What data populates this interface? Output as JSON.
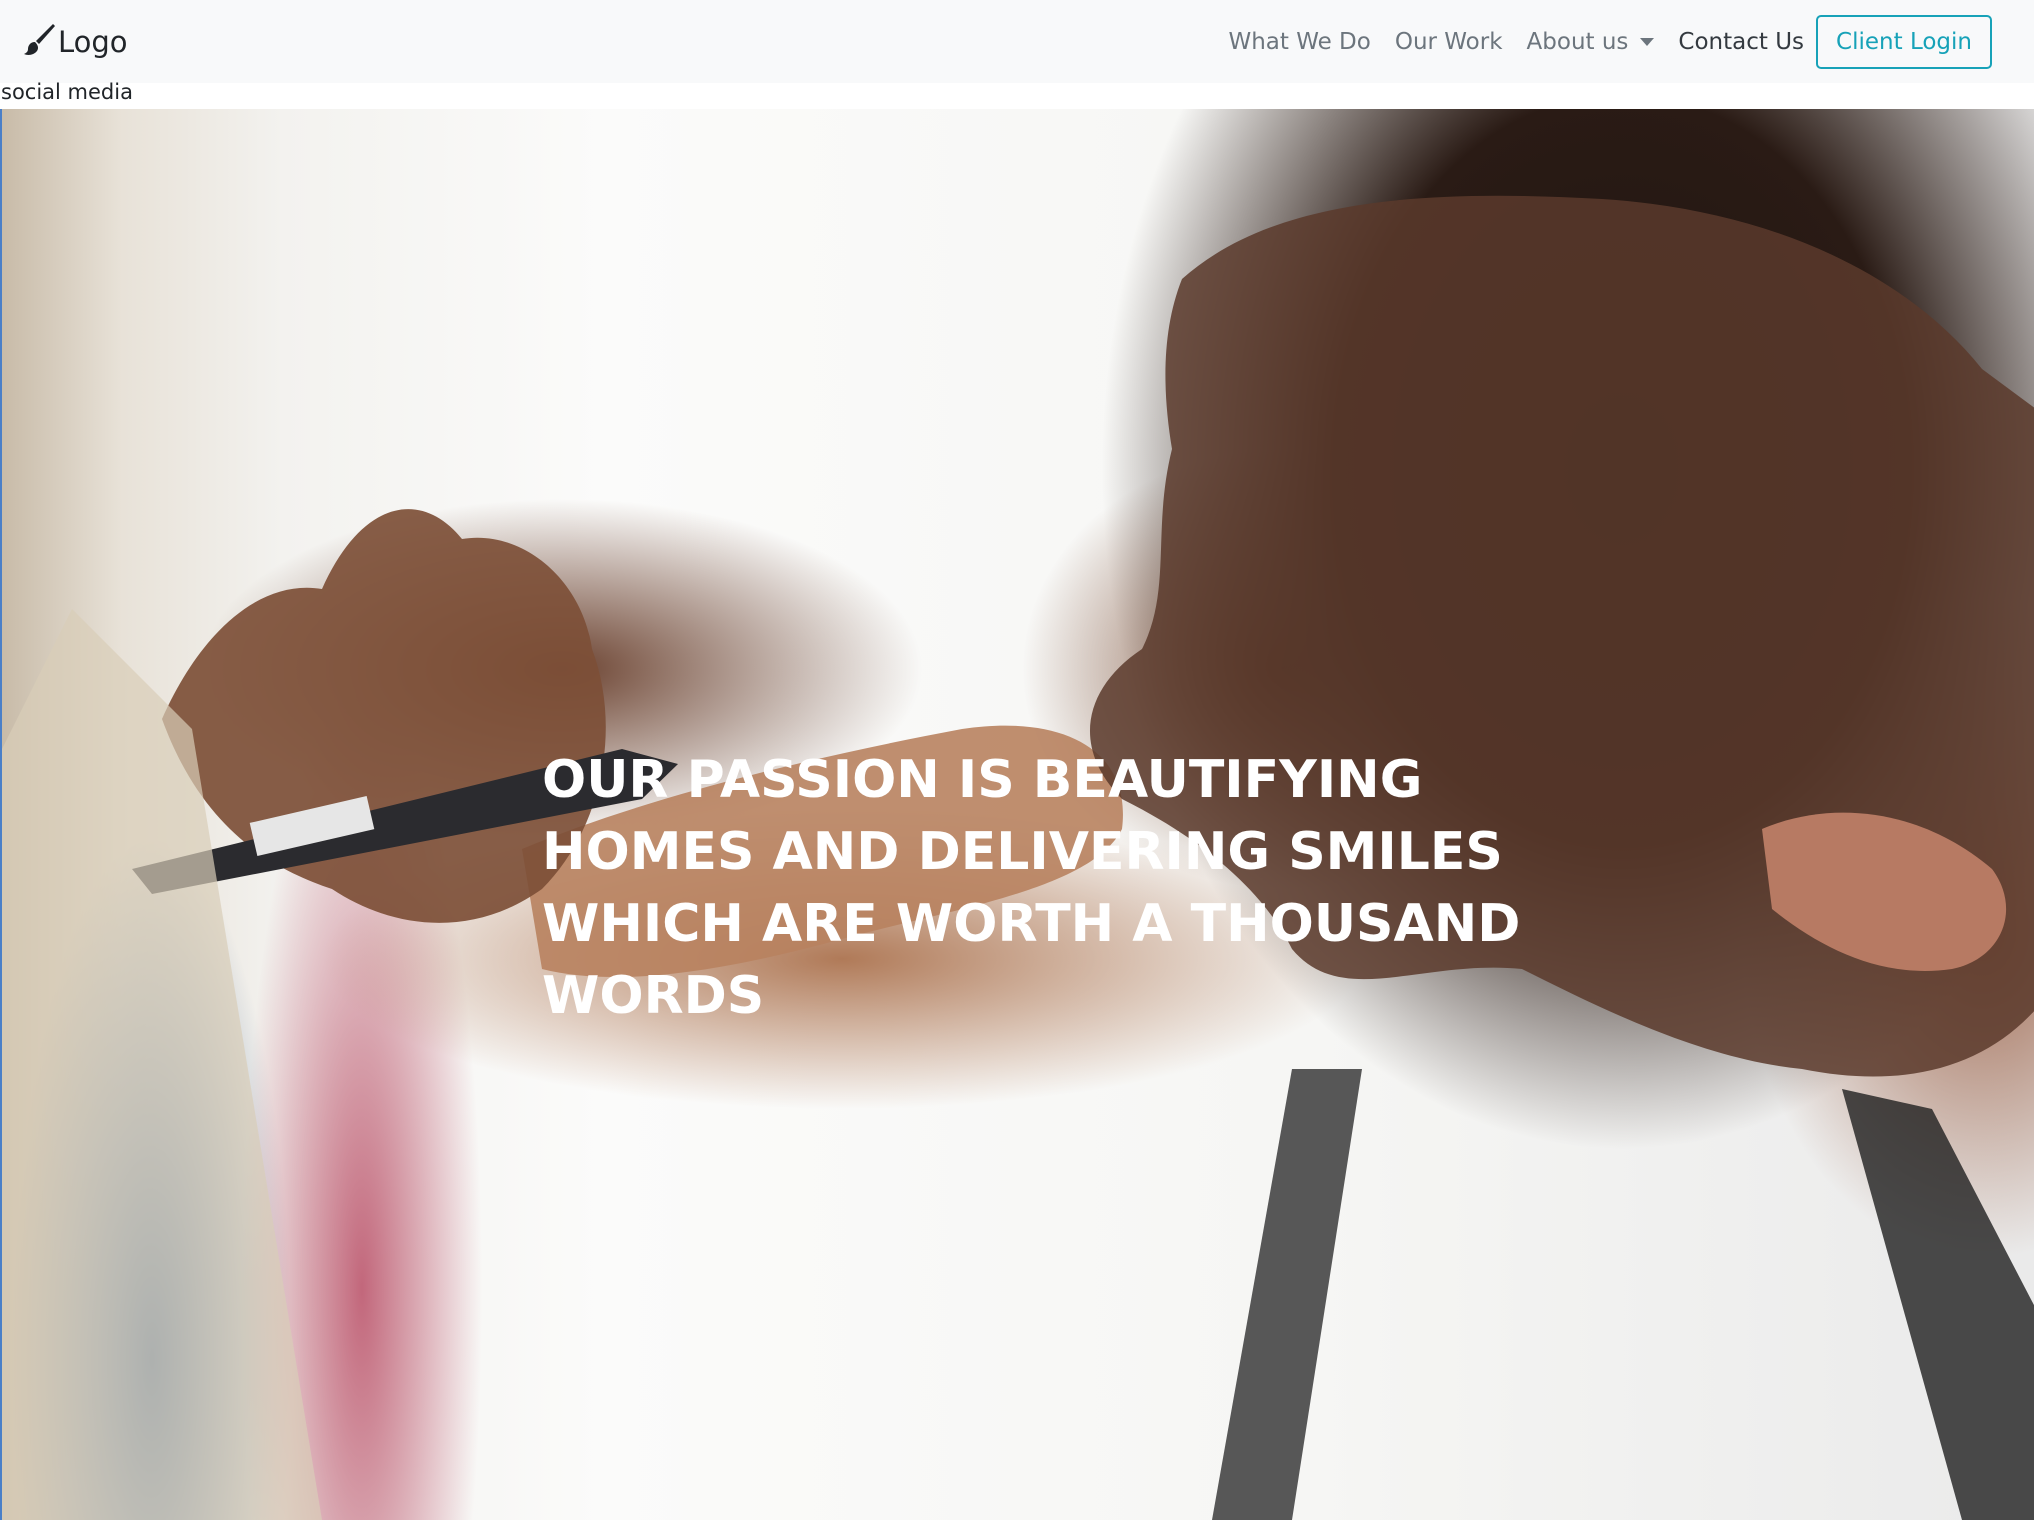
{
  "navbar": {
    "brand": {
      "icon": "paintbrush-icon",
      "label": "Logo"
    },
    "links": [
      {
        "label": "What We Do"
      },
      {
        "label": "Our Work"
      },
      {
        "label": "About us",
        "has_dropdown": true
      },
      {
        "label": "Contact Us",
        "active": true
      }
    ],
    "login_button": "Client Login"
  },
  "social_placeholder": "social media",
  "hero": {
    "headline": "OUR PASSION IS BEAUTIFYING HOMES AND DELIVERING SMILES WHICH ARE WORTH A THOUSAND WORDS",
    "image_description": "artist-drawing-with-marker"
  },
  "colors": {
    "navbar_bg": "#f8f9fa",
    "link": "#6c757d",
    "link_active": "#343a40",
    "accent": "#17a2b8",
    "headline": "#ffffff"
  }
}
